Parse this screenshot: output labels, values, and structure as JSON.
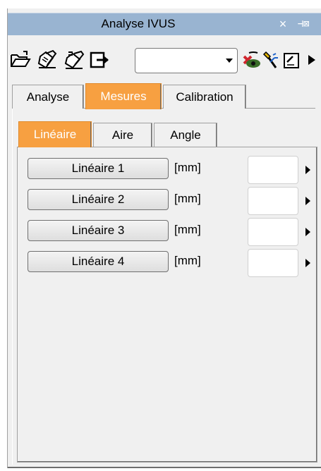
{
  "window": {
    "title": "Analyse IVUS",
    "close_glyph": "×",
    "pin_glyph": "⊣⊠"
  },
  "toolbar": {
    "icons": [
      "open-folder-icon",
      "edit-document-icon",
      "edit-document-copy-icon",
      "export-icon",
      "eye-no-icon",
      "magic-wand-icon",
      "checkbox-edit-icon",
      "chevron-right-icon"
    ],
    "combo_value": ""
  },
  "tabs": [
    {
      "label": "Analyse",
      "active": false
    },
    {
      "label": "Mesures",
      "active": true
    },
    {
      "label": "Calibration",
      "active": false
    }
  ],
  "subtabs": [
    {
      "label": "Linéaire",
      "active": true
    },
    {
      "label": "Aire",
      "active": false
    },
    {
      "label": "Angle",
      "active": false
    }
  ],
  "measures": [
    {
      "label": "Linéaire 1",
      "unit": "[mm]",
      "value": ""
    },
    {
      "label": "Linéaire 2",
      "unit": "[mm]",
      "value": ""
    },
    {
      "label": "Linéaire 3",
      "unit": "[mm]",
      "value": ""
    },
    {
      "label": "Linéaire 4",
      "unit": "[mm]",
      "value": ""
    }
  ],
  "colors": {
    "titlebar": "#99b4d1",
    "active_tab": "#f7a041",
    "background": "#f0f0f0"
  }
}
